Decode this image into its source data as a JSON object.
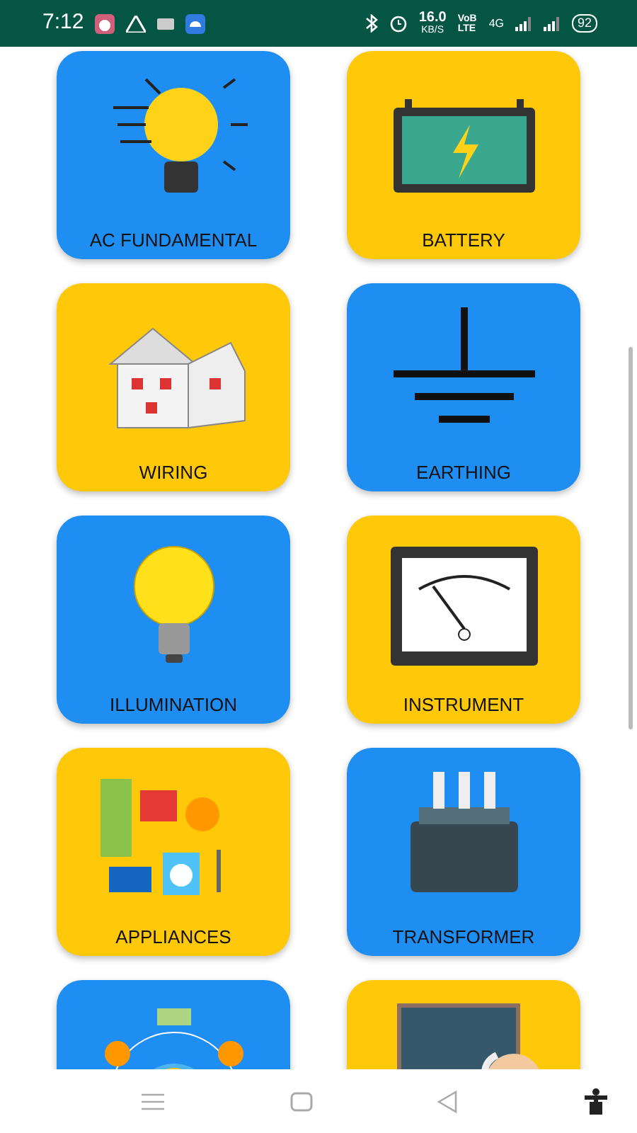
{
  "status_bar": {
    "time": "7:12",
    "speed": "16.0",
    "speed_unit": "KB/S",
    "volte": "VoB LTE",
    "network": "4G",
    "battery": "92"
  },
  "tiles": [
    {
      "label": "AC FUNDAMENTAL",
      "color": "#1e8ef2",
      "kind": "bulb-circuit"
    },
    {
      "label": "BATTERY",
      "color": "#ffc808",
      "kind": "battery"
    },
    {
      "label": "WIRING",
      "color": "#ffc808",
      "kind": "house"
    },
    {
      "label": "EARTHING",
      "color": "#1e8ef2",
      "kind": "ground"
    },
    {
      "label": "ILLUMINATION",
      "color": "#1e8ef2",
      "kind": "bulb"
    },
    {
      "label": "INSTRUMENT",
      "color": "#ffc808",
      "kind": "meter"
    },
    {
      "label": "APPLIANCES",
      "color": "#ffc808",
      "kind": "appliances"
    },
    {
      "label": "TRANSFORMER",
      "color": "#1e8ef2",
      "kind": "transformer"
    },
    {
      "color": "#1e8ef2",
      "kind": "worker"
    },
    {
      "color": "#ffc808",
      "kind": "teacher"
    }
  ]
}
